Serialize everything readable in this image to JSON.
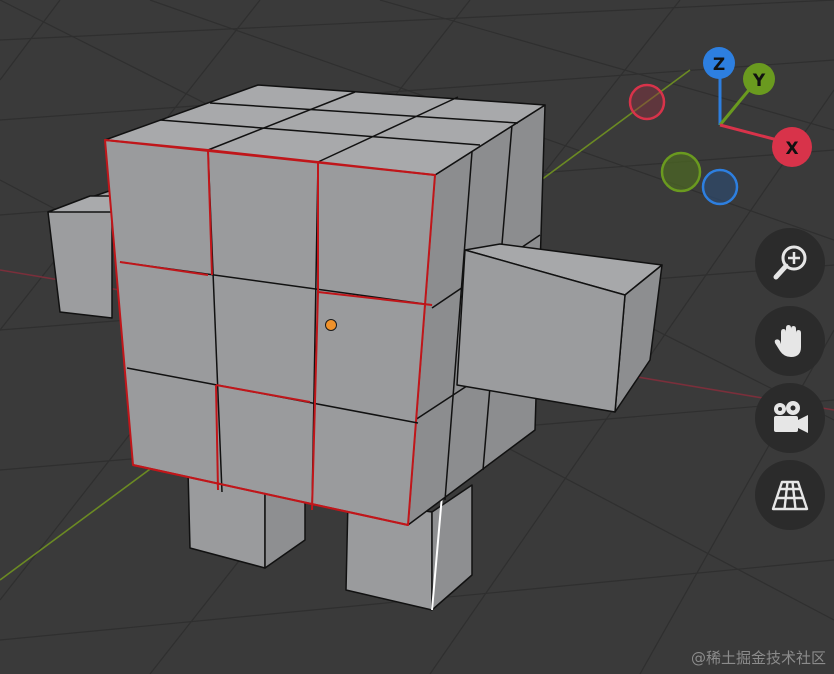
{
  "viewport": {
    "background": "#3a3a3a",
    "grid_color": "#2f2f2f",
    "x_axis_color": "#7a2f3b",
    "y_axis_color": "#6b8a23"
  },
  "model": {
    "face_color": "#9a9b9d",
    "face_dark_color": "#8a8b8d",
    "edge_color": "#111111",
    "selected_edge_color": "#c0161a",
    "origin_color": "#f0922b"
  },
  "gizmo": {
    "z_label": "Z",
    "y_label": "Y",
    "x_label": "X",
    "z_color": "#2d7fe0",
    "y_color": "#6a9a1f",
    "x_color": "#d8334a"
  },
  "nav_buttons": [
    {
      "name": "zoom",
      "icon": "zoom-in-icon"
    },
    {
      "name": "pan",
      "icon": "hand-icon"
    },
    {
      "name": "camera",
      "icon": "camera-icon"
    },
    {
      "name": "perspective",
      "icon": "grid-icon"
    }
  ],
  "watermark": "@稀土掘金技术社区"
}
